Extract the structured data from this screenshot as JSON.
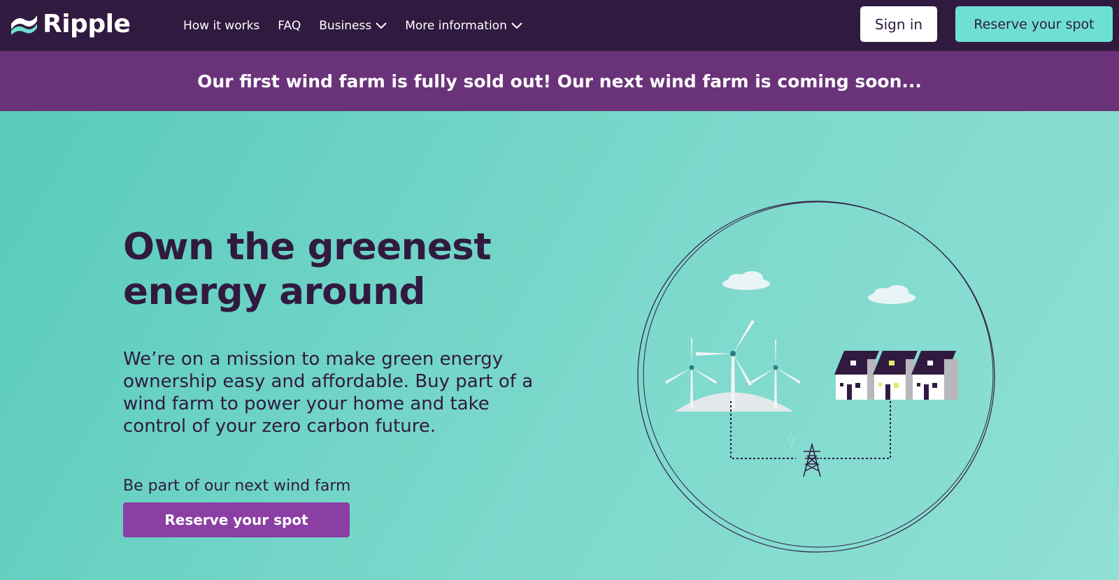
{
  "brand": {
    "name": "Ripple"
  },
  "nav": {
    "links": [
      {
        "label": "How it works",
        "has_dropdown": false
      },
      {
        "label": "FAQ",
        "has_dropdown": false
      },
      {
        "label": "Business",
        "has_dropdown": true
      },
      {
        "label": "More information",
        "has_dropdown": true
      }
    ],
    "signin_label": "Sign in",
    "reserve_label": "Reserve your spot"
  },
  "banner": {
    "text": "Our first wind farm is fully sold out! Our next wind farm is coming soon..."
  },
  "hero": {
    "title_line1": "Own the greenest",
    "title_line2": "energy around",
    "description": "We’re on a mission to make green energy ownership easy and affordable. Buy part of a wind farm to power your home and take control of your zero carbon future.",
    "subheading": "Be part of our next wind farm",
    "cta_label": "Reserve your spot",
    "illustration_icon": "wind-farm-houses-illustration"
  },
  "colors": {
    "nav_bg": "#311a40",
    "banner_bg": "#6a3279",
    "hero_bg": "#63cfc0",
    "accent_teal": "#6ee0d2",
    "cta_purple": "#8b3ea3",
    "text_dark": "#311a40"
  }
}
